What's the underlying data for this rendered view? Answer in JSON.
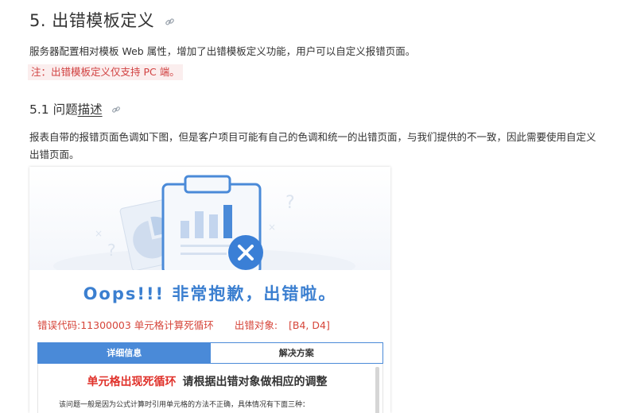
{
  "section": {
    "title": "5. 出错模板定义",
    "intro": "服务器配置相对模板 Web 属性，增加了出错模板定义功能，用户可以自定义报错页面。",
    "note": "注：出错模板定义仅支持 PC 端。"
  },
  "subsection": {
    "title_plain": "5.1 问题",
    "title_underlined": "描述",
    "body": "报表自带的报错页面色调如下图，但是客户项目可能有自己的色调和统一的出错页面，与我们提供的不一致，因此需要使用自定义出错页面。"
  },
  "error_page": {
    "headline": "Oops!!! 非常抱歉，出错啦。",
    "error_code_label": "错误代码:11300003 单元格计算死循环",
    "error_target_label": "出错对象:",
    "error_target_value": "[B4, D4]",
    "tabs": [
      {
        "label": "详细信息",
        "active": true
      },
      {
        "label": "解决方案",
        "active": false
      }
    ],
    "panel_title_red": "单元格出现死循环",
    "panel_title_dark": "请根据出错对象做相应的调整",
    "panel_desc": "该问题一般是因为公式计算时引用单元格的方法不正确，具体情况有下面三种："
  },
  "colors": {
    "accent_blue": "#4a8ad8",
    "oops_blue": "#3b7fd0",
    "error_red": "#d6453a",
    "note_bg": "#fbeeee",
    "note_text": "#d14141"
  },
  "icons": [
    "link-icon",
    "clipboard-chart-illustration",
    "close-icon"
  ]
}
